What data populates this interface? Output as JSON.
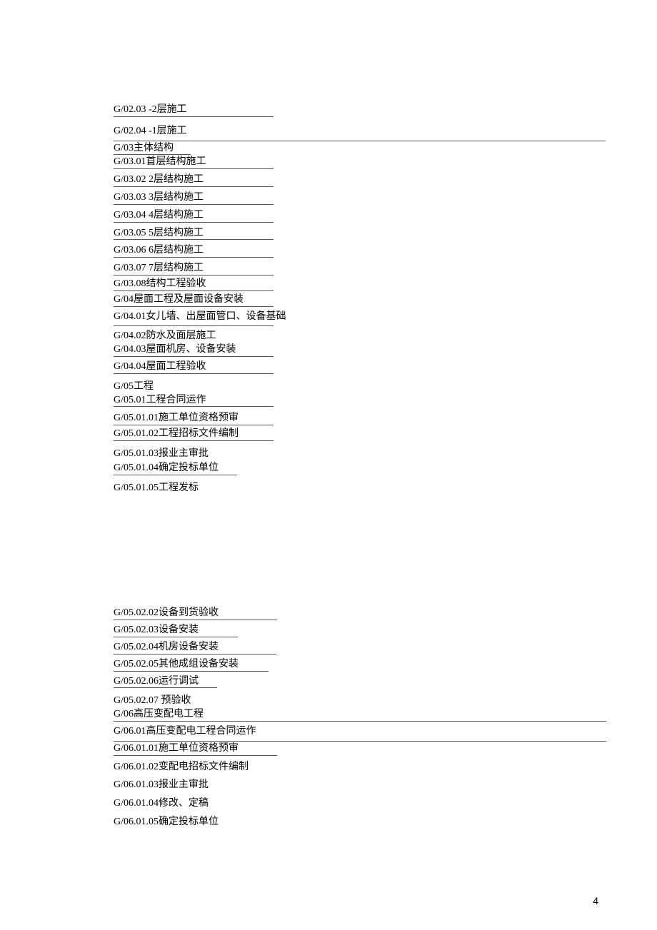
{
  "block1": [
    {
      "text": "G/02.03 -2层施工",
      "width": "u-mid",
      "underline": true
    },
    {
      "text": "G/02.04 -1层施工",
      "width": "",
      "underline": false
    },
    {
      "text": "",
      "width": "u-wide",
      "underline": true,
      "blank": true
    },
    {
      "text": "G/03主体结构",
      "width": "u-narrow",
      "underline": true
    },
    {
      "text": "G/03.01首层结构施工",
      "width": "u-mid",
      "underline": true
    },
    {
      "text": "G/03.02 2层结构施工",
      "width": "u-mid",
      "underline": true
    },
    {
      "text": "G/03.03 3层结构施工",
      "width": "u-mid",
      "underline": true
    },
    {
      "text": "G/03.04 4层结构施工",
      "width": "u-mid",
      "underline": true
    },
    {
      "text": "G/03.05 5层结构施工",
      "width": "u-mid",
      "underline": true
    },
    {
      "text": "G/03.06 6层结构施工",
      "width": "u-mid",
      "underline": true
    },
    {
      "text": "G/03.07 7层结构施工",
      "width": "u-mid",
      "underline": true
    },
    {
      "text": "G/03.08结构工程验收",
      "width": "u-mid",
      "underline": true
    },
    {
      "text": "G/04屋面工程及屋面设备安装",
      "width": "u-mid",
      "underline": true
    },
    {
      "text": "G/04.01女儿墙、出屋面管口、设备基础",
      "width": "",
      "underline": false
    },
    {
      "text": "",
      "width": "u-mid",
      "underline": true,
      "blank": true
    },
    {
      "text": "G/04.02防水及面层施工",
      "width": "",
      "underline": false
    },
    {
      "text": "G/04.03屋面机房、设备安装",
      "width": "u-mid",
      "underline": true
    },
    {
      "text": "G/04.04屋面工程验收",
      "width": "u-mid",
      "underline": true
    },
    {
      "text": "G/05工程",
      "width": "",
      "underline": false
    },
    {
      "text": "G/05.01工程合同运作",
      "width": "u-mid",
      "underline": true
    },
    {
      "text": "G/05.01.01施工单位资格预审",
      "width": "u-mid",
      "underline": true
    },
    {
      "text": "G/05.01.02工程招标文件编制",
      "width": "u-mid",
      "underline": true
    },
    {
      "text": "G/05.01.03报业主审批",
      "width": "",
      "underline": false
    },
    {
      "text": "G/05.01.04确定投标单位",
      "width": "u-173",
      "underline": true
    },
    {
      "text": "G/05.01.05工程发标",
      "width": "",
      "underline": false
    }
  ],
  "block2": [
    {
      "text": "G/05.02.02设备到货验收",
      "width": "u-229",
      "underline": true
    },
    {
      "text": "G/05.02.03设备安装",
      "width": "u-174",
      "underline": true
    },
    {
      "text": "G/05.02.04机房设备安装",
      "width": "u-228",
      "underline": true
    },
    {
      "text": "G/05.02.05其他成组设备安装",
      "width": "u-217",
      "underline": true
    },
    {
      "text": "G/05.02.06运行调试",
      "width": "u-145",
      "underline": true
    },
    {
      "text": "G/05.02.07 预验收",
      "width": "",
      "underline": false
    },
    {
      "text": "G/06高压变配电工程",
      "width": "u-wide2",
      "underline": true
    },
    {
      "text": "G/06.01高压变配电工程合同运作",
      "width": "",
      "underline": false
    },
    {
      "text": "",
      "width": "u-wide3",
      "underline": true,
      "blank": true
    },
    {
      "text": "G/06.01.01施工单位资格预审",
      "width": "u-229",
      "underline": true
    },
    {
      "text": "G/06.01.02变配电招标文件编制",
      "width": "",
      "underline": false
    },
    {
      "text": "G/06.01.03报业主审批",
      "width": "",
      "underline": false
    },
    {
      "text": "G/06.01.04修改、定稿",
      "width": "",
      "underline": false
    },
    {
      "text": "G/06.01.05确定投标单位",
      "width": "",
      "underline": false
    }
  ],
  "page_number": "4"
}
